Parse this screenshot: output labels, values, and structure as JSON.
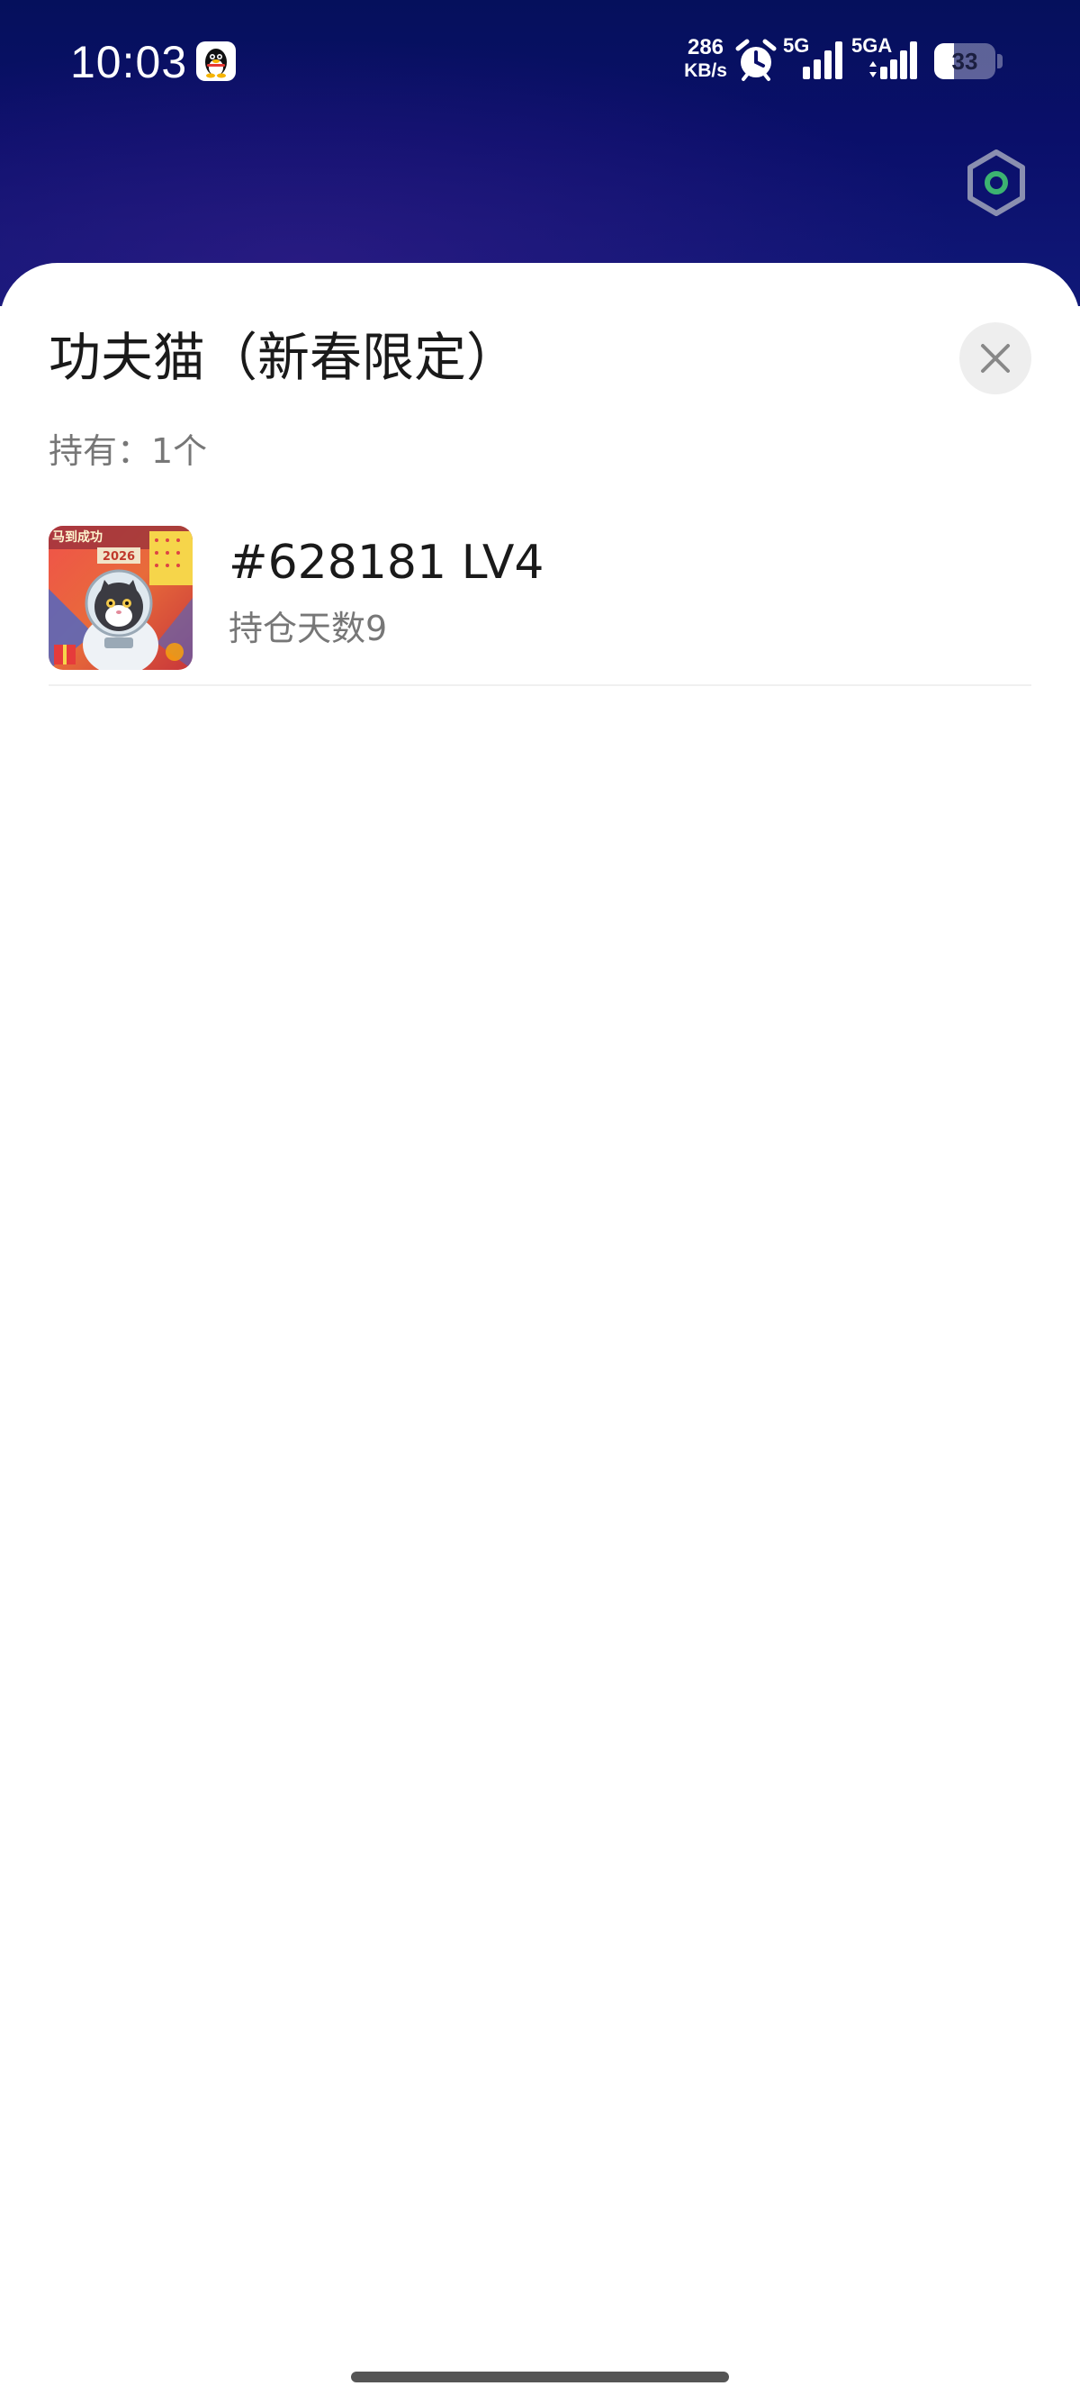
{
  "status_bar": {
    "time": "10:03",
    "notification_icon": "qq-penguin-icon",
    "net_speed_value": "286",
    "net_speed_unit": "KB/s",
    "alarm_icon": "alarm-clock-icon",
    "sim1_network": "5G",
    "sim2_network": "5GA",
    "battery_percent": "33",
    "battery_level": 0.33
  },
  "floating_button": {
    "icon": "hexagon-settings-icon",
    "accent_color": "#3cb371"
  },
  "sheet": {
    "title": "功夫猫（新春限定）",
    "holding_text": "持有：1个",
    "close_icon": "close-icon",
    "items": [
      {
        "id_level": "#628181 LV4",
        "hold_days": "持仓天数9",
        "thumb_badge_text": "马到成功",
        "thumb_year": "2026",
        "thumb_icon": "astronaut-cat-image"
      }
    ]
  }
}
